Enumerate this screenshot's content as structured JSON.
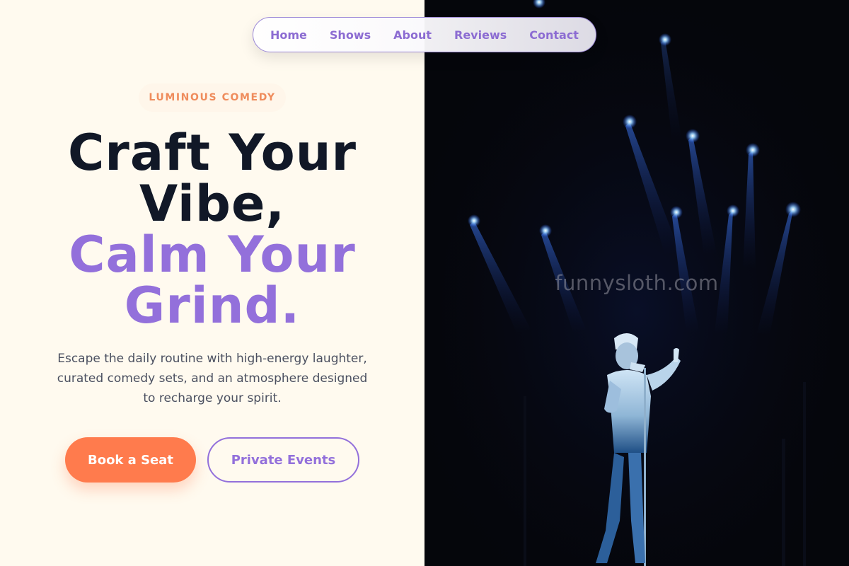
{
  "nav": {
    "items": [
      {
        "label": "Home"
      },
      {
        "label": "Shows"
      },
      {
        "label": "About"
      },
      {
        "label": "Reviews"
      },
      {
        "label": "Contact"
      }
    ]
  },
  "hero": {
    "badge": "LUMINOUS COMEDY",
    "headline_line1": "Craft Your",
    "headline_line2": "Vibe,",
    "headline_line3": "Calm Your",
    "headline_line4": "Grind.",
    "description": "Escape the daily routine with high-energy laughter, curated comedy sets, and an atmosphere designed to recharge your spirit.",
    "primary_button": "Book a Seat",
    "secondary_button": "Private Events"
  },
  "image": {
    "watermark": "funnysloth.com",
    "subject": "comedian performing on stage with microphone under blue spotlights"
  },
  "colors": {
    "background_left": "#fffaef",
    "background_right": "#05060b",
    "accent_purple": "#9370db",
    "accent_orange": "#ff7b4d",
    "badge_text": "#ef8c5c",
    "headline_dark": "#111827",
    "body_text": "#4b5060"
  }
}
